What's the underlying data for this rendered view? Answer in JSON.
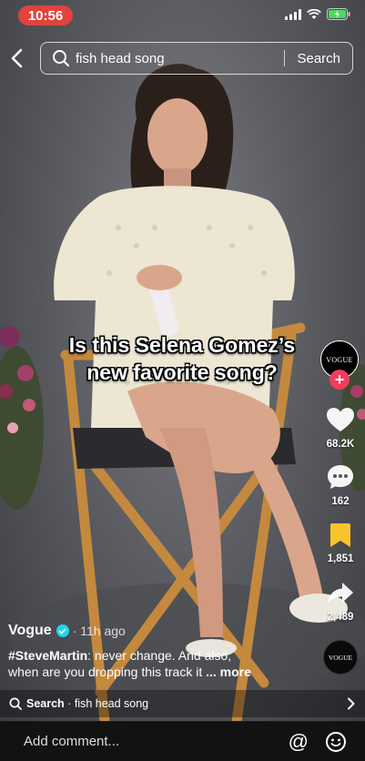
{
  "status_bar": {
    "time": "10:56",
    "battery_state": "charging"
  },
  "search": {
    "query": "fish head song",
    "button_label": "Search"
  },
  "caption": {
    "line1": "Is this Selena Gomez’s",
    "line2": "new favorite song?"
  },
  "creator": {
    "avatar_text": "VOGUE",
    "name": "Vogue",
    "time_ago": "· 11h ago"
  },
  "actions": {
    "likes": "68.2K",
    "comments": "162",
    "saves": "1,851",
    "shares": "2,489"
  },
  "description": {
    "hashtag": "#SteveMartin",
    "text_line1": ": never change. And also,",
    "text_line2": "when are you dropping this track it ",
    "more": "... more"
  },
  "related_search": {
    "prefix": "Search",
    "separator": " · ",
    "query": "fish head song"
  },
  "music_disc": {
    "text": "VOGUE"
  },
  "comment_bar": {
    "placeholder": "Add comment...",
    "mention_symbol": "@"
  },
  "colors": {
    "accent_red": "#f23d5c",
    "time_pill": "#e0443d",
    "save_yellow": "#f7c52b",
    "verified_cyan": "#20d5ec"
  },
  "icons": [
    "back-arrow-icon",
    "search-icon",
    "heart-icon",
    "comment-bubble-icon",
    "bookmark-icon",
    "share-arrow-icon",
    "emoji-icon",
    "chevron-right-icon"
  ]
}
